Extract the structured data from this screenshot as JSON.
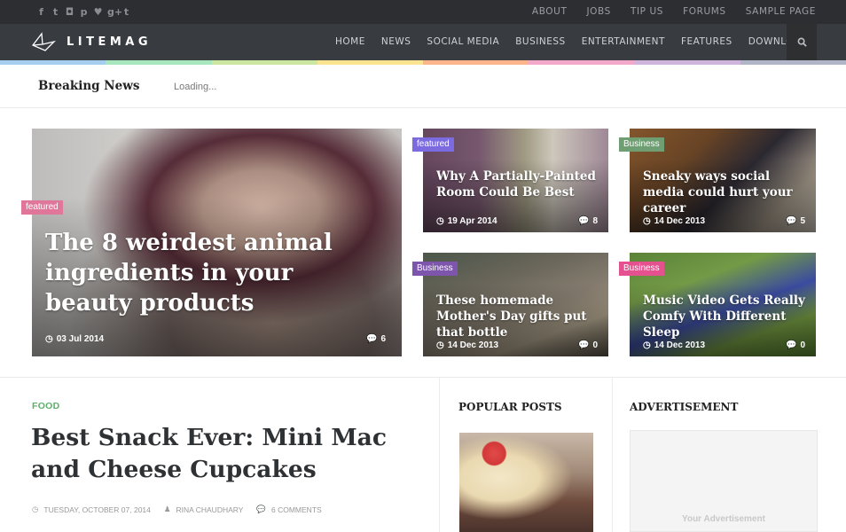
{
  "topbar": {
    "social_icons": [
      "facebook-icon",
      "twitter-icon",
      "instagram-icon",
      "pinterest-icon",
      "heart-icon",
      "google-plus-icon",
      "tumblr-icon"
    ],
    "social_glyphs": [
      "f",
      "t",
      "◘",
      "p",
      "♥",
      "g+",
      "t"
    ],
    "links": [
      "ABOUT",
      "JOBS",
      "TIP US",
      "FORUMS",
      "SAMPLE PAGE"
    ]
  },
  "navbar": {
    "logo_text": "LITEMAG",
    "items": [
      "HOME",
      "NEWS",
      "SOCIAL MEDIA",
      "BUSINESS",
      "ENTERTAINMENT",
      "FEATURES",
      "DOWNLOAD"
    ],
    "search_icon": "search-icon"
  },
  "color_strip": [
    "#a5cdee",
    "#a8e6bd",
    "#cbe6a0",
    "#fbe48f",
    "#fcb48a",
    "#f2a8c9",
    "#cfb5dd",
    "#b0b6c8"
  ],
  "breaking_news": {
    "title": "Breaking News",
    "text": "Loading..."
  },
  "featured": [
    {
      "tag": "featured",
      "tag_color": "#e0779a",
      "title": "The 8 weirdest animal ingredients in your beauty products",
      "date": "03 Jul 2014",
      "comments": "6"
    },
    {
      "tag": "featured",
      "tag_color": "#7b6ae0",
      "title": "Why A Partially-Painted Room Could Be Best",
      "date": "19 Apr 2014",
      "comments": "8"
    },
    {
      "tag": "Business",
      "tag_color": "#6f9e72",
      "title": "Sneaky ways social media could hurt your career",
      "date": "14 Dec 2013",
      "comments": "5"
    },
    {
      "tag": "Business",
      "tag_color": "#7d55ad",
      "title": "These homemade Mother's Day gifts put that bottle",
      "date": "14 Dec 2013",
      "comments": "0"
    },
    {
      "tag": "Business",
      "tag_color": "#e5508f",
      "title": "Music Video Gets Really Comfy With Different Sleep",
      "date": "14 Dec 2013",
      "comments": "0"
    }
  ],
  "post": {
    "category": "FOOD",
    "category_color": "#5bb06a",
    "title": "Best Snack Ever: Mini Mac and Cheese Cupcakes",
    "date": "TUESDAY, OCTOBER 07, 2014",
    "author": "RINA CHAUDHARY",
    "comments": "6 COMMENTS"
  },
  "sidebar": {
    "popular_title": "POPULAR POSTS",
    "ad_title": "ADVERTISEMENT",
    "ad_text": "Your Advertisement"
  }
}
